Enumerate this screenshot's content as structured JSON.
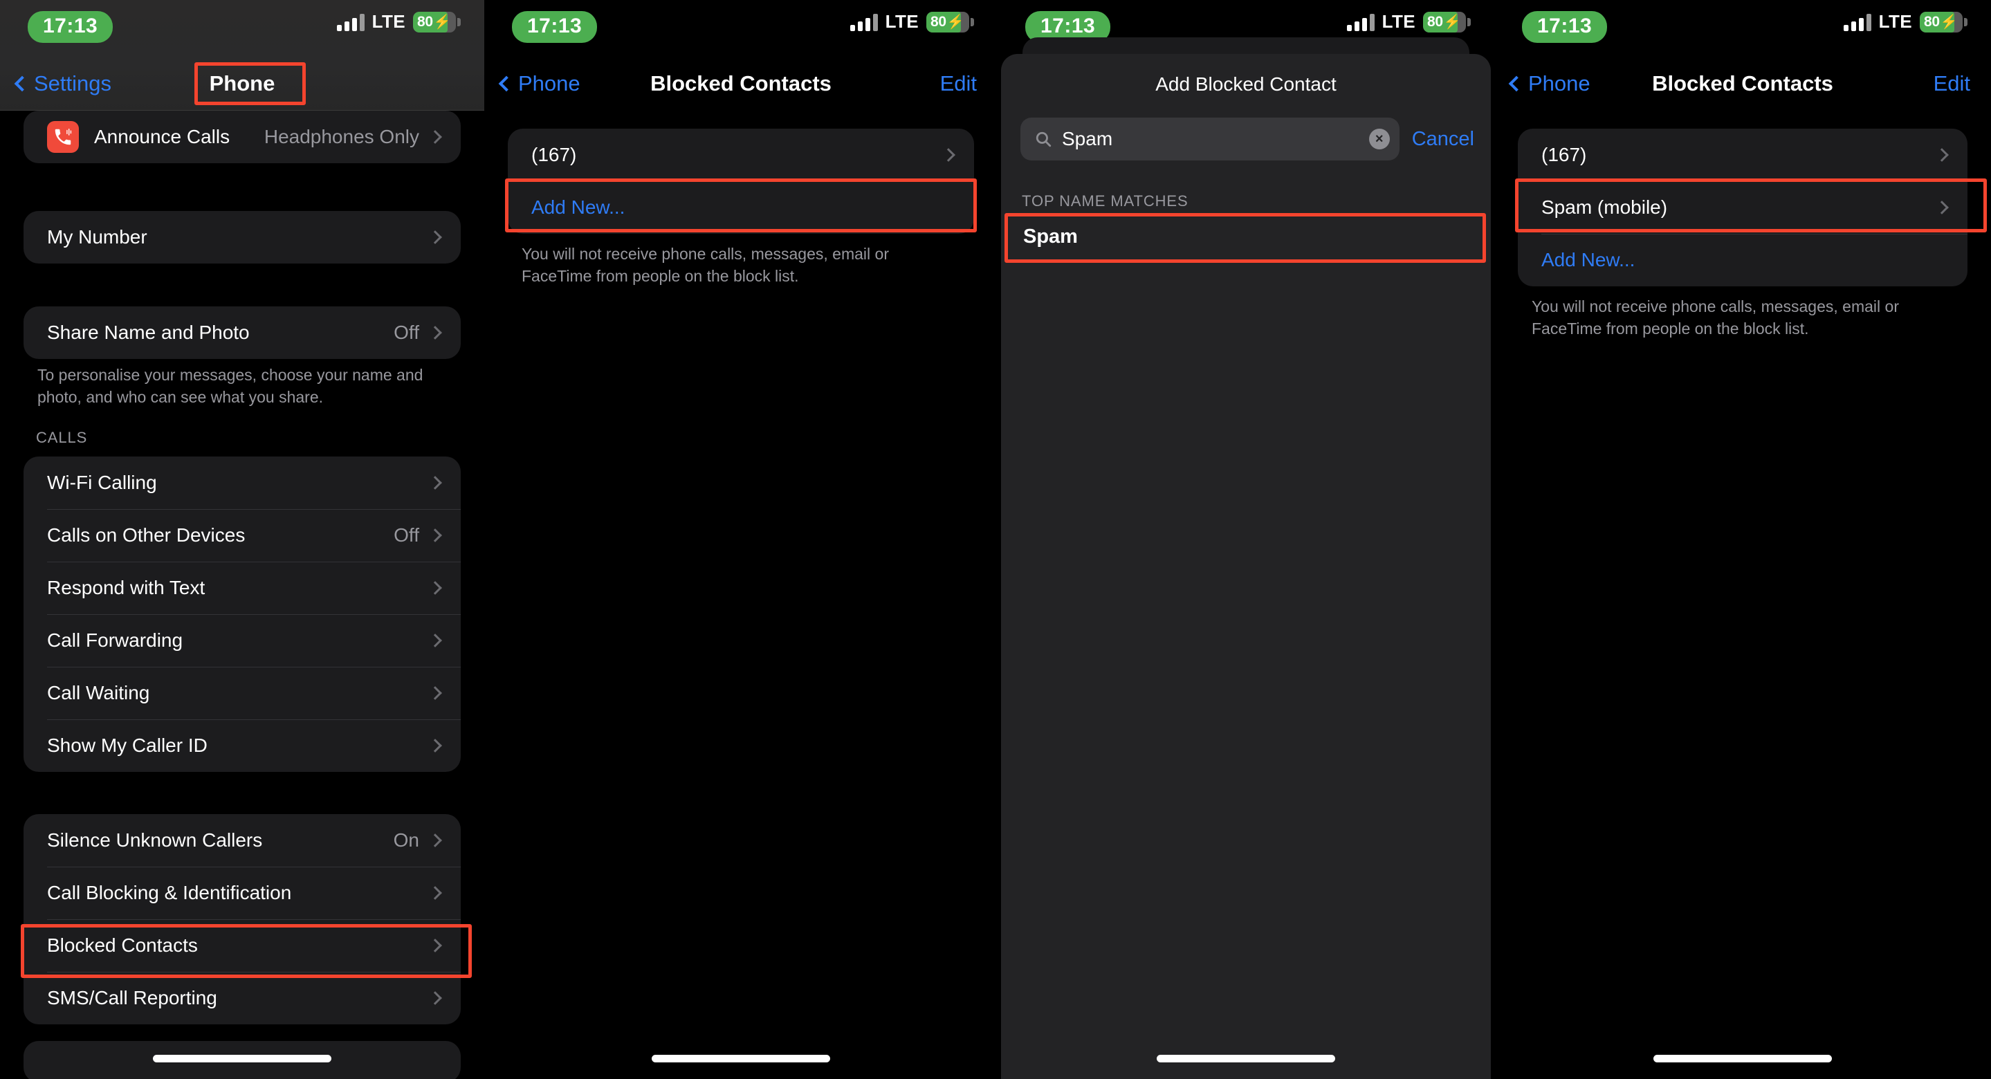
{
  "status": {
    "time": "17:13",
    "network": "LTE",
    "battery_percent": "80",
    "battery_bolt": "⚡",
    "signal_icon": "cellular-signal-icon"
  },
  "panel1": {
    "nav": {
      "back_label": "Settings",
      "title": "Phone"
    },
    "rows_top": [
      {
        "label": "Announce Calls",
        "value": "Headphones Only",
        "icon": "announce-calls-icon"
      }
    ],
    "rows_my_number": [
      {
        "label": "My Number",
        "value": ""
      }
    ],
    "rows_share": [
      {
        "label": "Share Name and Photo",
        "value": "Off"
      }
    ],
    "share_footnote": "To personalise your messages, choose your name and photo, and who can see what you share.",
    "calls_header": "CALLS",
    "rows_calls": [
      {
        "label": "Wi-Fi Calling",
        "value": ""
      },
      {
        "label": "Calls on Other Devices",
        "value": "Off"
      },
      {
        "label": "Respond with Text",
        "value": ""
      },
      {
        "label": "Call Forwarding",
        "value": ""
      },
      {
        "label": "Call Waiting",
        "value": ""
      },
      {
        "label": "Show My Caller ID",
        "value": ""
      }
    ],
    "rows_blocking": [
      {
        "label": "Silence Unknown Callers",
        "value": "On"
      },
      {
        "label": "Call Blocking & Identification",
        "value": ""
      },
      {
        "label": "Blocked Contacts",
        "value": ""
      },
      {
        "label": "SMS/Call Reporting",
        "value": ""
      }
    ]
  },
  "panel2": {
    "nav": {
      "back_label": "Phone",
      "title": "Blocked Contacts",
      "action_label": "Edit"
    },
    "rows": [
      {
        "label": "(167)",
        "style": "plain"
      },
      {
        "label": "Add New...",
        "style": "blue"
      }
    ],
    "footnote": "You will not receive phone calls, messages, email or FaceTime from people on the block list."
  },
  "panel3": {
    "sheet_title": "Add Blocked Contact",
    "search": {
      "value": "Spam",
      "placeholder": "Search",
      "clear_label": "×",
      "cancel_label": "Cancel"
    },
    "results_header": "TOP NAME MATCHES",
    "results": [
      {
        "label": "Spam"
      }
    ]
  },
  "panel4": {
    "nav": {
      "back_label": "Phone",
      "title": "Blocked Contacts",
      "action_label": "Edit"
    },
    "rows": [
      {
        "label": "(167)",
        "style": "plain"
      },
      {
        "label": "Spam (mobile)",
        "style": "plain"
      },
      {
        "label": "Add New...",
        "style": "blue"
      }
    ],
    "footnote": "You will not receive phone calls, messages, email or FaceTime from people on the block list."
  },
  "theme": {
    "accent_blue": "#2f7cf6",
    "highlight_red": "#f4442e",
    "battery_green": "#4cae50",
    "group_bg": "#1c1c1e",
    "secondary_text": "#98989e"
  }
}
